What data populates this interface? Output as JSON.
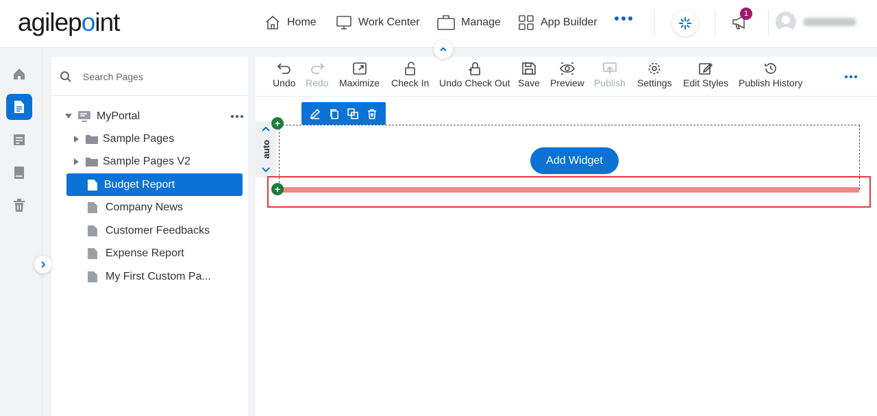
{
  "header": {
    "logo": {
      "prefix": "agilep",
      "mark": "o",
      "suffix": "int"
    },
    "nav": [
      {
        "label": "Home",
        "icon": "home-icon"
      },
      {
        "label": "Work Center",
        "icon": "monitor-icon"
      },
      {
        "label": "Manage",
        "icon": "briefcase-icon"
      },
      {
        "label": "App Builder",
        "icon": "grid-icon"
      }
    ],
    "more_icon": "more-horizontal-icon",
    "genie_icon": "genie-icon",
    "notification_count": "1",
    "notification_icon": "megaphone-icon",
    "user_icon": "user-avatar-icon"
  },
  "left_rail": {
    "items": [
      {
        "name": "home",
        "icon": "home-icon",
        "active": false
      },
      {
        "name": "pages",
        "icon": "page-icon",
        "active": true
      },
      {
        "name": "forms",
        "icon": "forms-icon",
        "active": false
      },
      {
        "name": "library",
        "icon": "book-icon",
        "active": false
      },
      {
        "name": "trash",
        "icon": "trash-icon",
        "active": false
      }
    ]
  },
  "pages_panel": {
    "search_placeholder": "Search Pages",
    "root": {
      "label": "MyPortal"
    },
    "items": [
      {
        "label": "Sample Pages",
        "type": "folder"
      },
      {
        "label": "Sample Pages V2",
        "type": "folder"
      },
      {
        "label": "Budget Report",
        "type": "page",
        "selected": true
      },
      {
        "label": "Company News",
        "type": "page"
      },
      {
        "label": "Customer Feedbacks",
        "type": "page"
      },
      {
        "label": "Expense Report",
        "type": "page"
      },
      {
        "label": "My First Custom Pa...",
        "type": "page"
      }
    ]
  },
  "toolbar": {
    "undo": "Undo",
    "redo": "Redo",
    "maximize": "Maximize",
    "check_in": "Check In",
    "undo_check_out": "Undo Check Out",
    "save": "Save",
    "preview": "Preview",
    "publish": "Publish",
    "settings": "Settings",
    "edit_styles": "Edit Styles",
    "publish_history": "Publish History"
  },
  "canvas": {
    "row_height_label": "auto",
    "add_widget_label": "Add Widget",
    "plus": "+"
  },
  "colors": {
    "accent": "#0b72d6",
    "badge": "#a3196c",
    "add_row_dot": "#1e7c3f",
    "drop_line": "#f08a8a",
    "highlight": "#e03a3a"
  }
}
